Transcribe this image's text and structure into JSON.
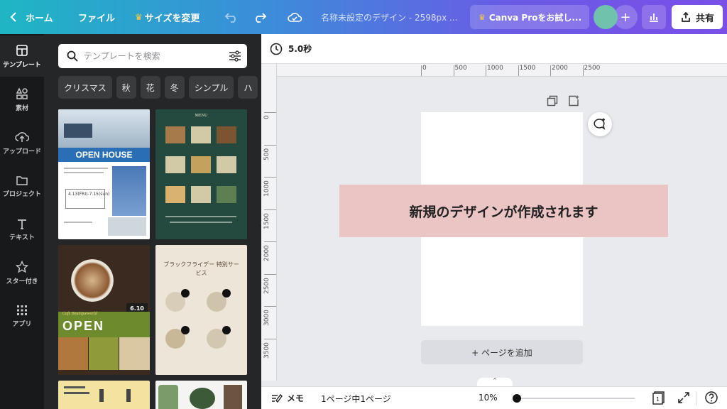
{
  "topbar": {
    "home_label": "ホーム",
    "file_label": "ファイル",
    "resize_label": "サイズを変更",
    "doc_title": "名称未設定のデザイン - 2598px ...",
    "pro_label": "Canva Proをお試し...",
    "plus_label": "+",
    "share_label": "共有",
    "crown_glyph": "♛"
  },
  "rail": {
    "items": [
      {
        "label": "テンプレート",
        "icon": "template-icon"
      },
      {
        "label": "素材",
        "icon": "elements-icon"
      },
      {
        "label": "アップロード",
        "icon": "upload-icon"
      },
      {
        "label": "プロジェクト",
        "icon": "folder-icon"
      },
      {
        "label": "テキスト",
        "icon": "text-icon"
      },
      {
        "label": "スター付き",
        "icon": "star-icon"
      },
      {
        "label": "アプリ",
        "icon": "apps-icon"
      }
    ]
  },
  "panel": {
    "search_placeholder": "テンプレートを検索",
    "chips": [
      "クリスマス",
      "秋",
      "花",
      "冬",
      "シンプル",
      "ハ"
    ],
    "templates": [
      {
        "title": "OPEN HOUSE",
        "sub": "4.13(FRI)-7.15(sun)",
        "theme": "openhouse"
      },
      {
        "title": "MENU",
        "theme": "menu"
      },
      {
        "title": "OPEN",
        "badge": "6.10",
        "script": "Cafe Boutiqueworld",
        "theme": "cafe"
      },
      {
        "title": "ブラックフライデー 特別サービス",
        "theme": "blackfriday"
      },
      {
        "title": "",
        "theme": "yellow"
      },
      {
        "title": "",
        "theme": "plants"
      }
    ]
  },
  "toolbar": {
    "duration": "5.0秒"
  },
  "rulers": {
    "top": [
      "0",
      "500",
      "1000",
      "1500",
      "2000",
      "2500"
    ],
    "left": [
      "0",
      "500",
      "1000",
      "1500",
      "2000",
      "2500",
      "3000",
      "3500"
    ]
  },
  "canvas": {
    "overlay_text": "新規のデザインが作成されます",
    "add_page_label": "+ ページを追加",
    "pull_up_glyph": "⌃"
  },
  "bottombar": {
    "notes_label": "メモ",
    "page_info": "1ページ中1ページ",
    "zoom": "10%",
    "zoom_level": 0.0
  },
  "colors": {
    "accent_gradient_start": "#1fb6c4",
    "accent_gradient_end": "#7a4fe8",
    "overlay_bg": "#ebc4c4",
    "avatar": "#71c2ad"
  }
}
